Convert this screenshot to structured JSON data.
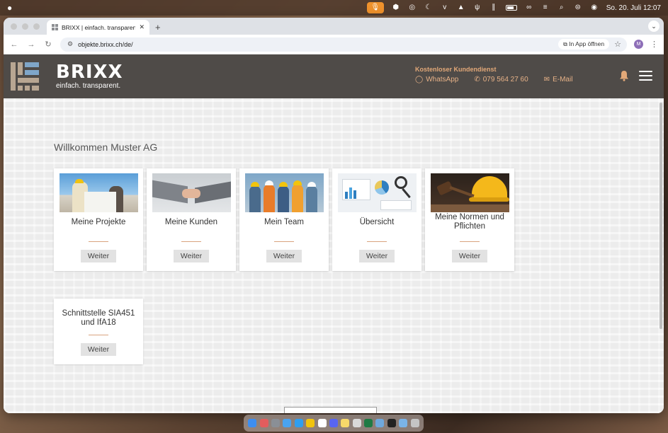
{
  "menubar": {
    "datetime": "So. 20. Juli  12:07"
  },
  "browser": {
    "tab_title": "BRIXX | einfach. transparent.",
    "url": "objekte.brixx.ch/de/",
    "open_in_app": "In App öffnen",
    "profile_initial": "M"
  },
  "header": {
    "brand": "BRIXX",
    "tagline": "einfach. transparent.",
    "service_title": "Kostenloser Kundendienst",
    "whatsapp": "WhatsApp",
    "phone": "079 564 27 60",
    "email": "E-Mail"
  },
  "main": {
    "welcome": "Willkommen Muster AG",
    "cards": [
      {
        "label": "Meine Projekte",
        "button": "Weiter"
      },
      {
        "label": "Meine Kunden",
        "button": "Weiter"
      },
      {
        "label": "Mein Team",
        "button": "Weiter"
      },
      {
        "label": "Übersicht",
        "button": "Weiter"
      },
      {
        "label": "Meine Normen und Pflichten",
        "button": "Weiter"
      },
      {
        "label": "Schnittstelle SIA451 und IfA18",
        "button": "Weiter"
      }
    ]
  },
  "colors": {
    "header_bg": "#4f4b48",
    "accent": "#e2a878",
    "logo_blue": "#7fa6c9"
  }
}
